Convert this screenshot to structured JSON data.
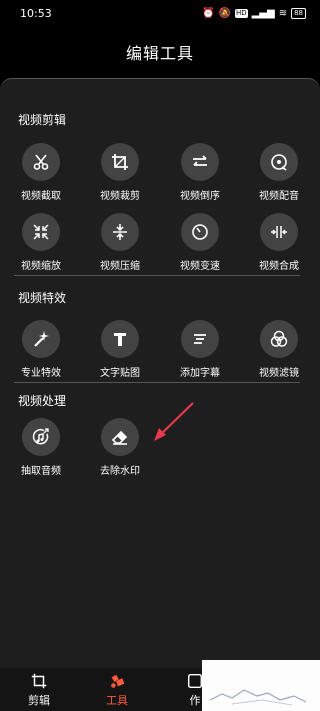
{
  "status": {
    "time": "10:53",
    "battery": "88",
    "net": "HD"
  },
  "header": {
    "title": "编辑工具"
  },
  "sections": [
    {
      "title": "视频剪辑"
    },
    {
      "title": "视频特效"
    },
    {
      "title": "视频处理"
    }
  ],
  "tools": {
    "clip": [
      {
        "label": "视频截取",
        "icon": "scissors-icon"
      },
      {
        "label": "视频裁剪",
        "icon": "crop-icon"
      },
      {
        "label": "视频倒序",
        "icon": "reverse-icon"
      },
      {
        "label": "视频配音",
        "icon": "dubbing-icon"
      },
      {
        "label": "视频缩放",
        "icon": "scale-icon"
      },
      {
        "label": "视频压缩",
        "icon": "compress-icon"
      },
      {
        "label": "视频变速",
        "icon": "speed-icon"
      },
      {
        "label": "视频合成",
        "icon": "merge-icon"
      }
    ],
    "effects": [
      {
        "label": "专业特效",
        "icon": "magic-icon"
      },
      {
        "label": "文字贴图",
        "icon": "text-icon"
      },
      {
        "label": "添加字幕",
        "icon": "subtitle-icon"
      },
      {
        "label": "视频滤镜",
        "icon": "filter-icon"
      }
    ],
    "process": [
      {
        "label": "抽取音频",
        "icon": "extract-audio-icon"
      },
      {
        "label": "去除水印",
        "icon": "eraser-icon"
      }
    ]
  },
  "nav": [
    {
      "label": "剪辑",
      "icon": "crop-nav-icon"
    },
    {
      "label": "工具",
      "icon": "tools-nav-icon"
    },
    {
      "label": "作",
      "icon": "works-nav-icon"
    }
  ],
  "colors": {
    "accent": "#ff5a3c",
    "arrow": "#e8384f"
  }
}
